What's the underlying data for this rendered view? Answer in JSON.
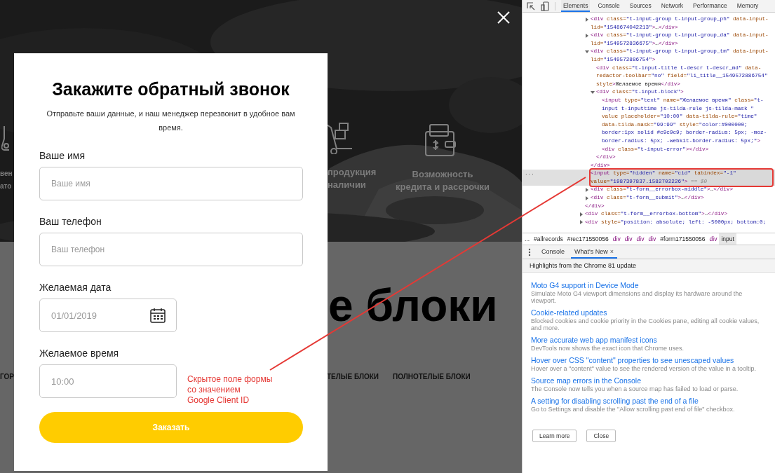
{
  "background": {
    "features": [
      {
        "kind": "flask",
        "text": "вен\nато"
      },
      {
        "kind": "cart",
        "text": "продукция\nналичии"
      },
      {
        "kind": "wallet",
        "text": "Возможность\nкредита и рассрочки"
      }
    ],
    "heading_fragments": [
      "е блоки"
    ],
    "nav_fragments": [
      "ГОР",
      "ТЕЛЫЕ БЛОКИ",
      "ПОЛНОТЕЛЫЕ БЛОКИ"
    ]
  },
  "modal": {
    "title": "Закажите обратный звонок",
    "subtitle": "Отправьте ваши данные, и наш менеджер перезвонит в удобное вам время.",
    "fields": [
      {
        "kind": "text",
        "label": "Ваше имя",
        "placeholder": "Ваше имя"
      },
      {
        "kind": "text",
        "label": "Ваш телефон",
        "placeholder": "Ваш телефон"
      },
      {
        "kind": "date",
        "label": "Желаемая дата",
        "placeholder": "01/01/2019"
      },
      {
        "kind": "time",
        "label": "Желаемое время",
        "placeholder": "10:00"
      }
    ],
    "submit": "Заказать"
  },
  "annotation": {
    "text": "Скрытое поле формы\nсо значением\nGoogle Client ID"
  },
  "devtools": {
    "tabs": [
      {
        "label": "Elements",
        "selected": true
      },
      {
        "label": "Console",
        "selected": false
      },
      {
        "label": "Sources",
        "selected": false
      },
      {
        "label": "Network",
        "selected": false
      },
      {
        "label": "Performance",
        "selected": false
      },
      {
        "label": "Memory",
        "selected": false
      }
    ],
    "dom": [
      {
        "children": [
          {
            "selected": false,
            "expanded": false,
            "tokens": [
              {
                "kind": "tag",
                "text": "<div"
              },
              {
                "kind": "attr",
                "text": " class="
              },
              {
                "kind": "value",
                "text": "\"t-input-group t-input-group_ph\""
              },
              {
                "kind": "attr",
                "text": " data-input-lid="
              },
              {
                "kind": "value",
                "text": "\"1548674042213\""
              },
              {
                "kind": "tag",
                "text": ">"
              },
              {
                "kind": "text",
                "text": "…"
              },
              {
                "kind": "tag",
                "text": "</div>"
              }
            ]
          },
          {
            "selected": false,
            "expanded": false,
            "tokens": [
              {
                "kind": "tag",
                "text": "<div"
              },
              {
                "kind": "attr",
                "text": " class="
              },
              {
                "kind": "value",
                "text": "\"t-input-group t-input-group_da\""
              },
              {
                "kind": "attr",
                "text": " data-input-lid="
              },
              {
                "kind": "value",
                "text": "\"1549572836675\""
              },
              {
                "kind": "tag",
                "text": ">"
              },
              {
                "kind": "text",
                "text": "…"
              },
              {
                "kind": "tag",
                "text": "</div>"
              }
            ]
          },
          {
            "selected": false,
            "expanded": true,
            "tokens": [
              {
                "kind": "tag",
                "text": "<div"
              },
              {
                "kind": "attr",
                "text": " class="
              },
              {
                "kind": "value",
                "text": "\"t-input-group t-input-group_tm\""
              },
              {
                "kind": "attr",
                "text": " data-input-lid="
              },
              {
                "kind": "value",
                "text": "\"1549572886754\""
              },
              {
                "kind": "tag",
                "text": ">"
              }
            ],
            "children": [
              {
                "selected": false,
                "tokens": [
                  {
                    "kind": "tag",
                    "text": "<div"
                  },
                  {
                    "kind": "attr",
                    "text": " class="
                  },
                  {
                    "kind": "value",
                    "text": "\"t-input-title t-descr t-descr_md\""
                  },
                  {
                    "kind": "attr",
                    "text": " data-redactor-toolbar="
                  },
                  {
                    "kind": "value",
                    "text": "\"no\""
                  },
                  {
                    "kind": "attr",
                    "text": " field="
                  },
                  {
                    "kind": "value",
                    "text": "\"li_title__1549572886754\""
                  },
                  {
                    "kind": "attr",
                    "text": " style"
                  },
                  {
                    "kind": "tag",
                    "text": ">"
                  },
                  {
                    "kind": "text",
                    "text": "Желаемое время"
                  },
                  {
                    "kind": "tag",
                    "text": "</div>"
                  }
                ]
              },
              {
                "selected": false,
                "expanded": true,
                "tokens": [
                  {
                    "kind": "tag",
                    "text": "<div"
                  },
                  {
                    "kind": "attr",
                    "text": " class="
                  },
                  {
                    "kind": "value",
                    "text": "\"t-input-block\""
                  },
                  {
                    "kind": "tag",
                    "text": ">"
                  }
                ],
                "children": [
                  {
                    "selected": false,
                    "tokens": [
                      {
                        "kind": "tag",
                        "text": "<input"
                      },
                      {
                        "kind": "attr",
                        "text": " type="
                      },
                      {
                        "kind": "value",
                        "text": "\"text\""
                      },
                      {
                        "kind": "attr",
                        "text": " name="
                      },
                      {
                        "kind": "value",
                        "text": "\"Желаемое время\""
                      },
                      {
                        "kind": "attr",
                        "text": " class="
                      },
                      {
                        "kind": "value",
                        "text": "\"t-input t-inputtime js-tilda-rule js-tilda-mask \""
                      },
                      {
                        "kind": "attr",
                        "text": " value placeholder="
                      },
                      {
                        "kind": "value",
                        "text": "\"10:00\""
                      },
                      {
                        "kind": "attr",
                        "text": " data-tilda-rule="
                      },
                      {
                        "kind": "value",
                        "text": "\"time\""
                      },
                      {
                        "kind": "attr",
                        "text": " data-tilda-mask="
                      },
                      {
                        "kind": "value",
                        "text": "\"99:99\""
                      },
                      {
                        "kind": "attr",
                        "text": " style="
                      },
                      {
                        "kind": "value",
                        "text": "\"color:#000000; border:1px solid #c9c9c9; border-radius: 5px; -moz-border-radius: 5px; -webkit-border-radius: 5px;\""
                      },
                      {
                        "kind": "tag",
                        "text": ">"
                      }
                    ]
                  },
                  {
                    "selected": false,
                    "tokens": [
                      {
                        "kind": "tag",
                        "text": "<div"
                      },
                      {
                        "kind": "attr",
                        "text": " class="
                      },
                      {
                        "kind": "value",
                        "text": "\"t-input-error\""
                      },
                      {
                        "kind": "tag",
                        "text": "></div>"
                      }
                    ]
                  }
                ],
                "end": [
                  {
                    "kind": "tag",
                    "text": "</div>"
                  }
                ]
              }
            ],
            "end": [
              {
                "kind": "tag",
                "text": "</div>"
              }
            ]
          },
          {
            "selected": true,
            "marker": "...",
            "tokens": [
              {
                "kind": "tag",
                "text": "<input"
              },
              {
                "kind": "attr",
                "text": " type="
              },
              {
                "kind": "value",
                "text": "\"hidden\""
              },
              {
                "kind": "attr",
                "text": " name="
              },
              {
                "kind": "value",
                "text": "\"cid\""
              },
              {
                "kind": "attr",
                "text": " tabindex="
              },
              {
                "kind": "value",
                "text": "\"-1\""
              },
              {
                "kind": "attr",
                "text": " value="
              },
              {
                "kind": "value",
                "text": "\"1987397837.1582702226\""
              },
              {
                "kind": "tag",
                "text": ">"
              },
              {
                "kind": "dim",
                "text": " == $0"
              }
            ]
          },
          {
            "selected": false,
            "expanded": false,
            "tokens": [
              {
                "kind": "tag",
                "text": "<div"
              },
              {
                "kind": "attr",
                "text": " class="
              },
              {
                "kind": "value",
                "text": "\"t-form__errorbox-middle\""
              },
              {
                "kind": "tag",
                "text": ">"
              },
              {
                "kind": "text",
                "text": "…"
              },
              {
                "kind": "tag",
                "text": "</div>"
              }
            ]
          },
          {
            "selected": false,
            "expanded": false,
            "tokens": [
              {
                "kind": "tag",
                "text": "<div"
              },
              {
                "kind": "attr",
                "text": " class="
              },
              {
                "kind": "value",
                "text": "\"t-form__submit\""
              },
              {
                "kind": "tag",
                "text": ">"
              },
              {
                "kind": "text",
                "text": "…"
              },
              {
                "kind": "tag",
                "text": "</div>"
              }
            ]
          }
        ],
        "end": [
          {
            "kind": "tag",
            "text": "</div>"
          }
        ]
      },
      {
        "selected": false,
        "expanded": false,
        "tokens": [
          {
            "kind": "tag",
            "text": "<div"
          },
          {
            "kind": "attr",
            "text": " class="
          },
          {
            "kind": "value",
            "text": "\"t-form__errorbox-bottom\""
          },
          {
            "kind": "tag",
            "text": ">"
          },
          {
            "kind": "text",
            "text": "…"
          },
          {
            "kind": "tag",
            "text": "</div>"
          }
        ]
      },
      {
        "selected": false,
        "expanded": false,
        "tokens": [
          {
            "kind": "tag",
            "text": "<div"
          },
          {
            "kind": "attr",
            "text": " style="
          },
          {
            "kind": "value",
            "text": "\"position: absolute; left: -5000px; bottom:0;"
          }
        ]
      }
    ],
    "breadcrumbs": [
      {
        "kind": "more",
        "text": "...",
        "selected": false
      },
      {
        "kind": "id",
        "text": "#allrecords",
        "selected": false
      },
      {
        "kind": "id",
        "text": "#rec171550056",
        "selected": false
      },
      {
        "kind": "tag",
        "text": "div",
        "selected": false
      },
      {
        "kind": "tag",
        "text": "div",
        "selected": false
      },
      {
        "kind": "tag",
        "text": "div",
        "selected": false
      },
      {
        "kind": "tag",
        "text": "div",
        "selected": false
      },
      {
        "kind": "id",
        "text": "#form171550056",
        "selected": false
      },
      {
        "kind": "tag",
        "text": "div",
        "selected": false
      },
      {
        "kind": "tag",
        "text": "input",
        "selected": true
      }
    ],
    "drawer_tabs": [
      {
        "label": "Console",
        "selected": false
      },
      {
        "label": "What's New",
        "selected": true,
        "close": "×"
      }
    ],
    "drawer_header": "Highlights from the Chrome 81 update",
    "news": [
      {
        "title": "Moto G4 support in Device Mode",
        "description": "Simulate Moto G4 viewport dimensions and display its hardware around the viewport."
      },
      {
        "title": "Cookie-related updates",
        "description": "Blocked cookies and cookie priority in the Cookies pane, editing all cookie values, and more."
      },
      {
        "title": "More accurate web app manifest icons",
        "description": "DevTools now shows the exact icon that Chrome uses."
      },
      {
        "title": "Hover over CSS \"content\" properties to see unescaped values",
        "description": "Hover over a \"content\" value to see the rendered version of the value in a tooltip."
      },
      {
        "title": "Source map errors in the Console",
        "description": "The Console now tells you when a source map has failed to load or parse."
      },
      {
        "title": "A setting for disabling scrolling past the end of a file",
        "description": "Go to Settings and disable the \"Allow scrolling past end of file\" checkbox."
      }
    ],
    "buttons": [
      "Learn more",
      "Close"
    ]
  }
}
